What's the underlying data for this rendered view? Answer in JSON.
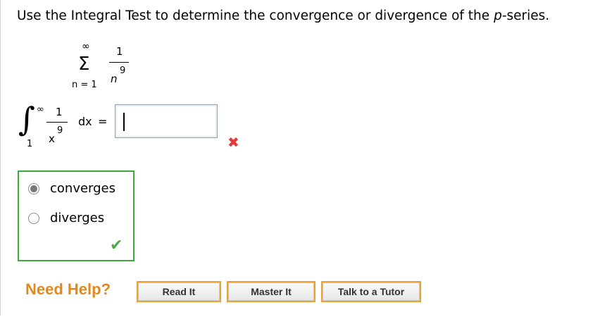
{
  "question": {
    "prefix": "Use the Integral Test to determine the convergence or divergence of the ",
    "p_letter": "p",
    "suffix": "-series."
  },
  "series": {
    "upper": "∞",
    "sigma": "Σ",
    "lower": "n = 1",
    "numerator": "1",
    "denominator_var": "n",
    "exponent": "9"
  },
  "integral": {
    "symbol": "∫",
    "upper": "∞",
    "lower": "1",
    "numerator": "1",
    "denominator_var": "x",
    "exponent": "9",
    "differential": "dx",
    "equals": "="
  },
  "answer": {
    "value": "",
    "status_icon": "x-mark",
    "status_color": "#e03b3b"
  },
  "choices": [
    {
      "label": "converges",
      "selected": true
    },
    {
      "label": "diverges",
      "selected": false
    }
  ],
  "choices_status_icon": "checkmark",
  "choices_status_color": "#4aa847",
  "help": {
    "title": "Need Help?",
    "buttons": [
      "Read It",
      "Master It",
      "Talk to a Tutor"
    ]
  },
  "colors": {
    "accent_orange": "#f0a030",
    "correct_green": "#3cab3c"
  }
}
